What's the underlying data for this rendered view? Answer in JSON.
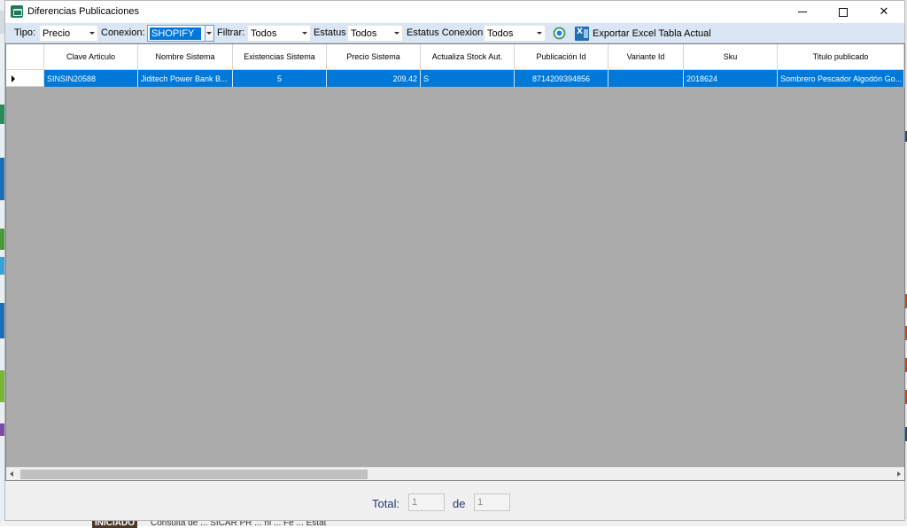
{
  "window": {
    "title": "Diferencias Publicaciones",
    "minimize_glyph": "",
    "close_glyph": "✕"
  },
  "toolbar": {
    "tipo_label": "Tipo:",
    "tipo_value": "Precio",
    "conexion_label": "Conexion:",
    "conexion_value": "SHOPIFY",
    "filtrar_label": "Filtrar:",
    "filtrar_value": "Todos",
    "estatus_label": "Estatus",
    "estatus_value": "Todos",
    "estatus_conexion_label": "Estatus Conexion:",
    "estatus_conexion_value": "Todos",
    "refresh_icon": "refresh-icon",
    "export_label": "Exportar Excel Tabla Actual",
    "export_icon": "excel-icon"
  },
  "grid": {
    "columns": [
      "Clave Articulo",
      "Nombre Sistema",
      "Existencias Sistema",
      "Precio Sistema",
      "Actualiza Stock Aut.",
      "Publicación Id",
      "Variante Id",
      "Sku",
      "Titulo publicado"
    ],
    "rows": [
      {
        "clave_articulo": "SINSIN20588",
        "nombre_sistema": "Jiditech Power Bank B...",
        "existencias_sistema": "5",
        "precio_sistema": "209.42",
        "actualiza_stock_aut": "S",
        "publicacion_id": "8714209394856",
        "variante_id": "",
        "sku": "2018624",
        "titulo_publicado": "Sombrero Pescador Algodón Go..."
      }
    ],
    "selection_color": "#0078d7"
  },
  "footer": {
    "total_label": "Total:",
    "total_value": "1",
    "de_label": "de",
    "de_value": "1"
  },
  "background": {
    "status_badge": "INICIADO",
    "status_text": "Consulta de ... SICAR  PR ... ni ... Fe ... Estat"
  }
}
